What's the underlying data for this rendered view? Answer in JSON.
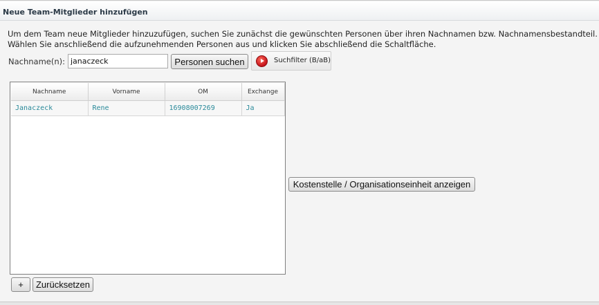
{
  "panel": {
    "title": "Neue Team-Mitglieder hinzufügen"
  },
  "intro": {
    "line1": "Um dem Team neue Mitglieder hinzuzufügen, suchen Sie zunächst die gewünschten Personen über ihren Nachnamen bzw. Nachnamensbestandteil.",
    "line2": "Wählen Sie anschließend die aufzunehmenden Personen aus und klicken Sie abschließend die Schaltfläche."
  },
  "search": {
    "label": "Nachname(n):",
    "value": "janaczeck",
    "button_label": "Personen suchen",
    "filter_label": "Suchfilter (B/aB)"
  },
  "grid": {
    "columns": [
      "Nachname",
      "Vorname",
      "OM",
      "Exchange"
    ],
    "rows": [
      [
        "Janaczeck",
        "Rene",
        "16908007269",
        "Ja"
      ]
    ]
  },
  "actions": {
    "kosten_label": "Kostenstelle / Organisationseinheit anzeigen",
    "add_label": "+",
    "reset_label": "Zurücksetzen"
  },
  "colors": {
    "link_text": "#2a8a9a",
    "filter_icon": "#c4121a"
  },
  "icons": {
    "filter": "play-circle-icon"
  }
}
